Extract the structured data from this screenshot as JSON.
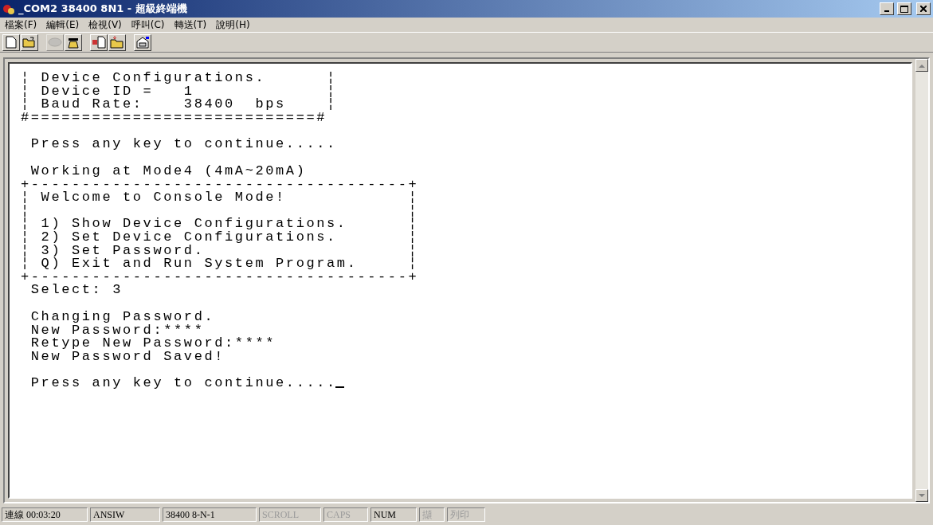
{
  "window": {
    "title": "_COM2 38400 8N1 - 超級終端機"
  },
  "menu": [
    "檔案(F)",
    "編輯(E)",
    "檢視(V)",
    "呼叫(C)",
    "轉送(T)",
    "說明(H)"
  ],
  "toolbar": [
    {
      "kind": "new",
      "disabled": false
    },
    {
      "kind": "open",
      "disabled": false
    },
    {
      "kind": "disconnect",
      "disabled": true
    },
    {
      "kind": "dial",
      "disabled": false
    },
    {
      "kind": "send",
      "disabled": false
    },
    {
      "kind": "receive",
      "disabled": false
    },
    {
      "kind": "properties",
      "disabled": false
    }
  ],
  "terminal": {
    "blocks": [
      [
        "¦ Device Configurations.      ¦",
        "¦ Device ID =   1             ¦",
        "¦ Baud Rate:    38400  bps    ¦",
        "#============================#"
      ],
      [
        " Press any key to continue....."
      ],
      [
        " Working at Mode4 (4mA~20mA)",
        "+-------------------------------------+",
        "¦ Welcome to Console Mode!            ¦",
        "¦                                     ¦",
        "¦ 1) Show Device Configurations.      ¦",
        "¦ 2) Set Device Configurations.       ¦",
        "¦ 3) Set Password.                    ¦",
        "¦ Q) Exit and Run System Program.     ¦",
        "+-------------------------------------+",
        " Select: 3"
      ],
      [
        " Changing Password.",
        " New Password:****",
        " Retype New Password:****",
        " New Password Saved!"
      ],
      [
        " Press any key to continue....."
      ]
    ],
    "cursor": true
  },
  "status_bar": [
    {
      "text": "連線 00:03:20",
      "active": true
    },
    {
      "text": "ANSIW",
      "active": true
    },
    {
      "text": "38400 8-N-1",
      "active": true
    },
    {
      "text": "SCROLL",
      "active": false
    },
    {
      "text": "CAPS",
      "active": false
    },
    {
      "text": "NUM",
      "active": true
    },
    {
      "text": "擷",
      "active": false
    },
    {
      "text": "列印",
      "active": false
    }
  ]
}
